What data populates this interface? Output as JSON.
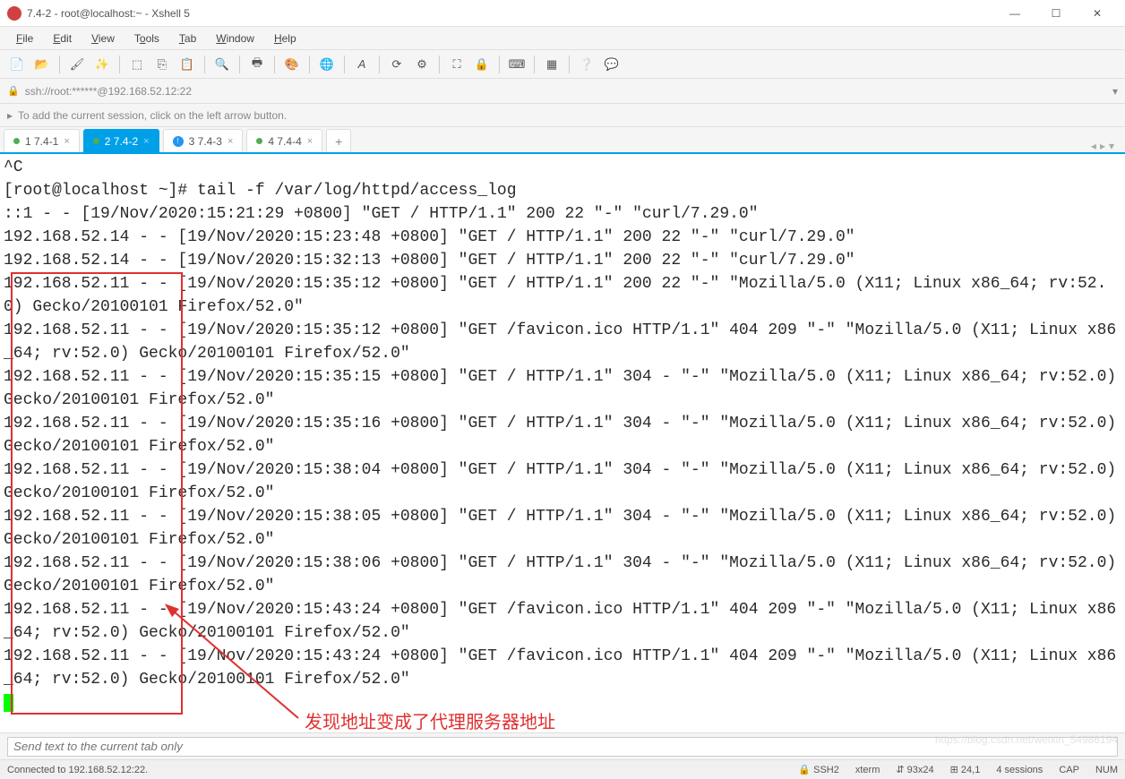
{
  "window": {
    "title": "7.4-2 - root@localhost:~ - Xshell 5"
  },
  "menu": {
    "file": "File",
    "edit": "Edit",
    "view": "View",
    "tools": "Tools",
    "tab": "Tab",
    "window": "Window",
    "help": "Help"
  },
  "address": "ssh://root:******@192.168.52.12:22",
  "hint": "To add the current session, click on the left arrow button.",
  "tabs": [
    {
      "label": "1 7.4-1",
      "indicator": "green"
    },
    {
      "label": "2 7.4-2",
      "indicator": "green",
      "active": true
    },
    {
      "label": "3 7.4-3",
      "indicator": "info"
    },
    {
      "label": "4 7.4-4",
      "indicator": "green"
    }
  ],
  "terminal_lines": [
    "^C",
    "[root@localhost ~]# tail -f /var/log/httpd/access_log",
    "::1 - - [19/Nov/2020:15:21:29 +0800] \"GET / HTTP/1.1\" 200 22 \"-\" \"curl/7.29.0\"",
    "192.168.52.14 - - [19/Nov/2020:15:23:48 +0800] \"GET / HTTP/1.1\" 200 22 \"-\" \"curl/7.29.0\"",
    "192.168.52.14 - - [19/Nov/2020:15:32:13 +0800] \"GET / HTTP/1.1\" 200 22 \"-\" \"curl/7.29.0\"",
    "192.168.52.11 - - [19/Nov/2020:15:35:12 +0800] \"GET / HTTP/1.1\" 200 22 \"-\" \"Mozilla/5.0 (X11; Linux x86_64; rv:52.0) Gecko/20100101 Firefox/52.0\"",
    "192.168.52.11 - - [19/Nov/2020:15:35:12 +0800] \"GET /favicon.ico HTTP/1.1\" 404 209 \"-\" \"Mozilla/5.0 (X11; Linux x86_64; rv:52.0) Gecko/20100101 Firefox/52.0\"",
    "192.168.52.11 - - [19/Nov/2020:15:35:15 +0800] \"GET / HTTP/1.1\" 304 - \"-\" \"Mozilla/5.0 (X11; Linux x86_64; rv:52.0) Gecko/20100101 Firefox/52.0\"",
    "192.168.52.11 - - [19/Nov/2020:15:35:16 +0800] \"GET / HTTP/1.1\" 304 - \"-\" \"Mozilla/5.0 (X11; Linux x86_64; rv:52.0) Gecko/20100101 Firefox/52.0\"",
    "192.168.52.11 - - [19/Nov/2020:15:38:04 +0800] \"GET / HTTP/1.1\" 304 - \"-\" \"Mozilla/5.0 (X11; Linux x86_64; rv:52.0) Gecko/20100101 Firefox/52.0\"",
    "192.168.52.11 - - [19/Nov/2020:15:38:05 +0800] \"GET / HTTP/1.1\" 304 - \"-\" \"Mozilla/5.0 (X11; Linux x86_64; rv:52.0) Gecko/20100101 Firefox/52.0\"",
    "192.168.52.11 - - [19/Nov/2020:15:38:06 +0800] \"GET / HTTP/1.1\" 304 - \"-\" \"Mozilla/5.0 (X11; Linux x86_64; rv:52.0) Gecko/20100101 Firefox/52.0\"",
    "192.168.52.11 - - [19/Nov/2020:15:43:24 +0800] \"GET /favicon.ico HTTP/1.1\" 404 209 \"-\" \"Mozilla/5.0 (X11; Linux x86_64; rv:52.0) Gecko/20100101 Firefox/52.0\"",
    "192.168.52.11 - - [19/Nov/2020:15:43:24 +0800] \"GET /favicon.ico HTTP/1.1\" 404 209 \"-\" \"Mozilla/5.0 (X11; Linux x86_64; rv:52.0) Gecko/20100101 Firefox/52.0\""
  ],
  "annotation": "发现地址变成了代理服务器地址",
  "send_placeholder": "Send text to the current tab only",
  "status": {
    "connected": "Connected to 192.168.52.12:22.",
    "protocol": "SSH2",
    "term": "xterm",
    "size": "93x24",
    "pos": "24,1",
    "sessions": "4 sessions",
    "cap": "CAP",
    "num": "NUM"
  },
  "watermark": "https://blog.csdn.net/weixin_54986194"
}
